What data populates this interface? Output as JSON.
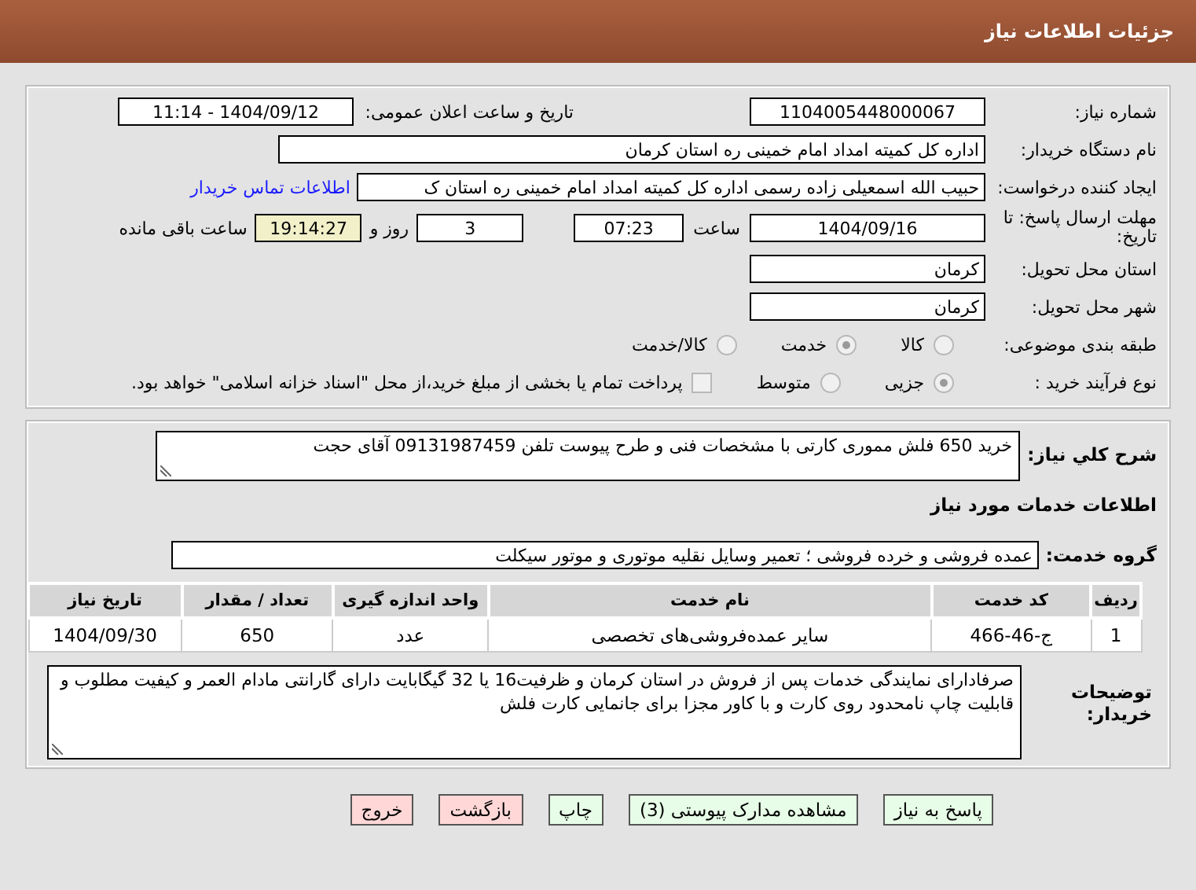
{
  "header": {
    "title": "جزئیات اطلاعات نیاز"
  },
  "details": {
    "need_number": {
      "label": "شماره نیاز:",
      "value": "1104005448000067"
    },
    "announce": {
      "label": "تاریخ و ساعت اعلان عمومی:",
      "value": "1404/09/12 - 11:14"
    },
    "buyer": {
      "label": "نام دستگاه خریدار:",
      "value": "اداره کل کمیته امداد امام خمینی  ره  استان کرمان"
    },
    "requester": {
      "label": "ایجاد کننده درخواست:",
      "value": "حبیب الله اسمعیلی زاده رسمی  اداره کل کمیته امداد امام خمینی  ره  استان ک",
      "link": "اطلاعات تماس خریدار"
    },
    "deadline": {
      "label": "مهلت ارسال پاسخ: تا تاریخ:",
      "date": "1404/09/16",
      "time_label": "ساعت",
      "time": "07:23",
      "days": "3",
      "days_label": "روز و",
      "remaining": "19:14:27",
      "remaining_label": "ساعت باقی مانده"
    },
    "province": {
      "label": "استان محل تحویل:",
      "value": "کرمان"
    },
    "city": {
      "label": "شهر محل تحویل:",
      "value": "کرمان"
    },
    "category": {
      "label": "طبقه بندی موضوعی:",
      "options": [
        {
          "label": "کالا",
          "selected": false
        },
        {
          "label": "خدمت",
          "selected": true
        },
        {
          "label": "کالا/خدمت",
          "selected": false
        }
      ]
    },
    "process": {
      "label": "نوع فرآیند خرید :",
      "options": [
        {
          "label": "جزیی",
          "selected": true
        },
        {
          "label": "متوسط",
          "selected": false
        }
      ],
      "checkbox": {
        "label": "پرداخت تمام یا بخشی از مبلغ خرید،از محل \"اسناد خزانه اسلامی\" خواهد بود.",
        "checked": false
      }
    }
  },
  "description": {
    "label": "شرح کلي نیاز:",
    "value": "خرید 650 فلش مموری کارتی با مشخصات فنی و طرح پیوست تلفن 09131987459 آقای حجت"
  },
  "services_title": "اطلاعات خدمات مورد نیاز",
  "service_group": {
    "label": "گروه خدمت:",
    "value": "عمده فروشی و خرده فروشی ؛ تعمیر وسایل نقلیه موتوری و موتور سیکلت"
  },
  "table": {
    "columns": [
      "ردیف",
      "کد خدمت",
      "نام خدمت",
      "واحد اندازه گیری",
      "تعداد / مقدار",
      "تاریخ نیاز"
    ],
    "rows": [
      [
        "1",
        "ج-46-466",
        "سایر عمده‌فروشی‌های تخصصی",
        "عدد",
        "650",
        "1404/09/30"
      ]
    ]
  },
  "buyer_notes": {
    "label": "توضیحات خریدار:",
    "value": "صرفادارای نمایندگی خدمات پس از فروش در استان کرمان و ظرفیت16 یا 32 گیگابایت دارای گارانتی مادام العمر و کیفیت مطلوب و قابلیت چاپ نامحدود روی کارت و با کاور مجزا برای جانمایی کارت فلش"
  },
  "buttons": [
    {
      "label": "پاسخ به نیاز",
      "kind": "action"
    },
    {
      "label": "مشاهده مدارک پیوستی (3)",
      "kind": "action"
    },
    {
      "label": "چاپ",
      "kind": "action"
    },
    {
      "label": "بازگشت",
      "kind": "exit"
    },
    {
      "label": "خروج",
      "kind": "exit"
    }
  ]
}
